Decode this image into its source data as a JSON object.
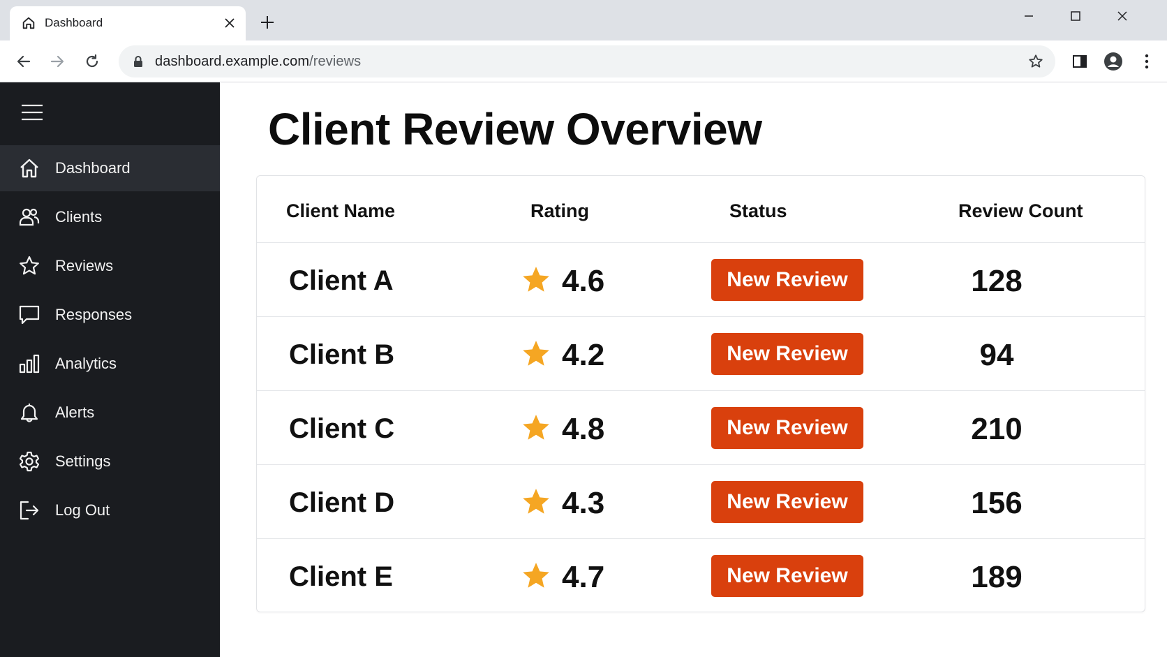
{
  "browser": {
    "tab_title": "Dashboard",
    "url_host": "dashboard.example.com",
    "url_path": "/reviews"
  },
  "sidebar": {
    "items": [
      {
        "label": "Dashboard",
        "icon": "home-icon",
        "active": true
      },
      {
        "label": "Clients",
        "icon": "users-icon",
        "active": false
      },
      {
        "label": "Reviews",
        "icon": "star-outline-icon",
        "active": false
      },
      {
        "label": "Responses",
        "icon": "chat-bubble-icon",
        "active": false
      },
      {
        "label": "Analytics",
        "icon": "bar-chart-icon",
        "active": false
      },
      {
        "label": "Alerts",
        "icon": "bell-icon",
        "active": false
      },
      {
        "label": "Settings",
        "icon": "gear-icon",
        "active": false
      },
      {
        "label": "Log Out",
        "icon": "logout-icon",
        "active": false
      }
    ]
  },
  "main": {
    "title": "Client Review Overview",
    "table": {
      "columns": [
        "Client Name",
        "Rating",
        "Status",
        "Review Count"
      ],
      "rows": [
        {
          "name": "Client A",
          "rating": "4.6",
          "status": "New Review",
          "count": "128"
        },
        {
          "name": "Client B",
          "rating": "4.2",
          "status": "New Review",
          "count": "94"
        },
        {
          "name": "Client C",
          "rating": "4.8",
          "status": "New Review",
          "count": "210"
        },
        {
          "name": "Client D",
          "rating": "4.3",
          "status": "New Review",
          "count": "156"
        },
        {
          "name": "Client E",
          "rating": "4.7",
          "status": "New Review",
          "count": "189"
        }
      ]
    }
  },
  "colors": {
    "sidebar_bg": "#1a1c20",
    "sidebar_active": "#2a2d33",
    "badge": "#d9400d",
    "star": "#f5a623"
  }
}
